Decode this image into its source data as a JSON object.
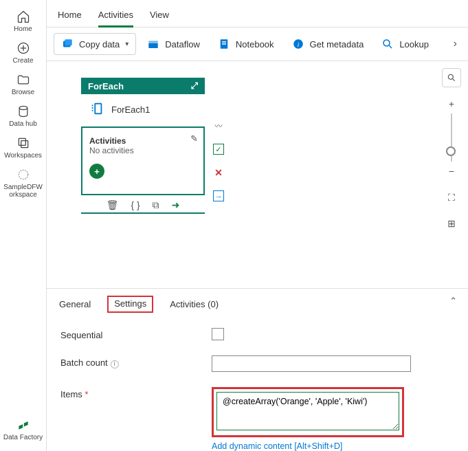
{
  "rail": {
    "home": "Home",
    "create": "Create",
    "browse": "Browse",
    "datahub": "Data hub",
    "workspaces": "Workspaces",
    "sample": "SampleDFW orkspace",
    "bottom": "Data Factory"
  },
  "topTabs": {
    "home": "Home",
    "activities": "Activities",
    "view": "View"
  },
  "ribbon": {
    "copydata": "Copy data",
    "dataflow": "Dataflow",
    "notebook": "Notebook",
    "getmeta": "Get metadata",
    "lookup": "Lookup"
  },
  "foreach": {
    "type": "ForEach",
    "name": "ForEach1",
    "actLabel": "Activities",
    "actSub": "No activities"
  },
  "lowerTabs": {
    "general": "General",
    "settings": "Settings",
    "activities": "Activities (0)"
  },
  "form": {
    "sequential": "Sequential",
    "batch": "Batch count",
    "items": "Items",
    "itemsValue": "@createArray('Orange', 'Apple', 'Kiwi')",
    "dynamic": "Add dynamic content [Alt+Shift+D]"
  }
}
